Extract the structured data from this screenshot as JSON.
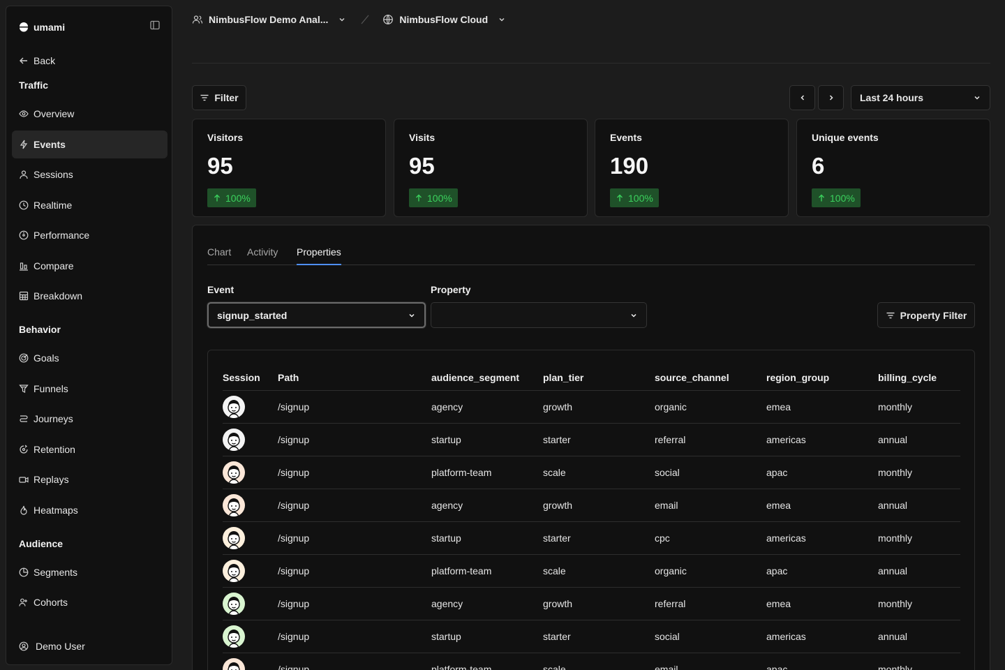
{
  "sidebar": {
    "brand": "umami",
    "back": "Back",
    "sections": {
      "traffic": "Traffic",
      "behavior": "Behavior",
      "audience": "Audience"
    },
    "traffic_items": [
      {
        "label": "Overview",
        "icon": "eye-icon"
      },
      {
        "label": "Events",
        "icon": "lightning-icon"
      },
      {
        "label": "Sessions",
        "icon": "user-icon"
      },
      {
        "label": "Realtime",
        "icon": "clock-icon"
      },
      {
        "label": "Performance",
        "icon": "gauge-icon"
      },
      {
        "label": "Compare",
        "icon": "compare-icon"
      },
      {
        "label": "Breakdown",
        "icon": "grid-icon"
      }
    ],
    "behavior_items": [
      {
        "label": "Goals",
        "icon": "target-icon"
      },
      {
        "label": "Funnels",
        "icon": "funnel-icon"
      },
      {
        "label": "Journeys",
        "icon": "journey-icon"
      },
      {
        "label": "Retention",
        "icon": "retention-icon"
      },
      {
        "label": "Replays",
        "icon": "video-icon"
      },
      {
        "label": "Heatmaps",
        "icon": "flame-icon"
      }
    ],
    "audience_items": [
      {
        "label": "Segments",
        "icon": "pie-icon"
      },
      {
        "label": "Cohorts",
        "icon": "users-icon"
      }
    ],
    "user": "Demo User"
  },
  "header": {
    "team": "NimbusFlow Demo Anal...",
    "website": "NimbusFlow Cloud"
  },
  "toolbar": {
    "filter": "Filter",
    "date_range": "Last 24 hours"
  },
  "metrics": [
    {
      "label": "Visitors",
      "value": "95",
      "change": "100%"
    },
    {
      "label": "Visits",
      "value": "95",
      "change": "100%"
    },
    {
      "label": "Events",
      "value": "190",
      "change": "100%"
    },
    {
      "label": "Unique events",
      "value": "6",
      "change": "100%"
    }
  ],
  "tabs": [
    "Chart",
    "Activity",
    "Properties"
  ],
  "active_tab": "Properties",
  "event_field": {
    "label": "Event",
    "value": "signup_started"
  },
  "property_field": {
    "label": "Property",
    "value": ""
  },
  "property_filter": "Property Filter",
  "table": {
    "columns": [
      "Session",
      "Path",
      "audience_segment",
      "plan_tier",
      "source_channel",
      "region_group",
      "billing_cycle"
    ],
    "rows": [
      {
        "avatar": "#f4f4f4",
        "path": "/signup",
        "audience_segment": "agency",
        "plan_tier": "growth",
        "source_channel": "organic",
        "region_group": "emea",
        "billing_cycle": "monthly"
      },
      {
        "avatar": "#f4f4f4",
        "path": "/signup",
        "audience_segment": "startup",
        "plan_tier": "starter",
        "source_channel": "referral",
        "region_group": "americas",
        "billing_cycle": "annual"
      },
      {
        "avatar": "#fbe7d8",
        "path": "/signup",
        "audience_segment": "platform-team",
        "plan_tier": "scale",
        "source_channel": "social",
        "region_group": "apac",
        "billing_cycle": "monthly"
      },
      {
        "avatar": "#fbe7d8",
        "path": "/signup",
        "audience_segment": "agency",
        "plan_tier": "growth",
        "source_channel": "email",
        "region_group": "emea",
        "billing_cycle": "annual"
      },
      {
        "avatar": "#fdf0dd",
        "path": "/signup",
        "audience_segment": "startup",
        "plan_tier": "starter",
        "source_channel": "cpc",
        "region_group": "americas",
        "billing_cycle": "monthly"
      },
      {
        "avatar": "#fdf0dd",
        "path": "/signup",
        "audience_segment": "platform-team",
        "plan_tier": "scale",
        "source_channel": "organic",
        "region_group": "apac",
        "billing_cycle": "annual"
      },
      {
        "avatar": "#d9f5d0",
        "path": "/signup",
        "audience_segment": "agency",
        "plan_tier": "growth",
        "source_channel": "referral",
        "region_group": "emea",
        "billing_cycle": "monthly"
      },
      {
        "avatar": "#d9f5d0",
        "path": "/signup",
        "audience_segment": "startup",
        "plan_tier": "starter",
        "source_channel": "social",
        "region_group": "americas",
        "billing_cycle": "annual"
      },
      {
        "avatar": "#fbe7d8",
        "path": "/signup",
        "audience_segment": "platform-team",
        "plan_tier": "scale",
        "source_channel": "email",
        "region_group": "apac",
        "billing_cycle": "monthly"
      }
    ]
  },
  "colors": {
    "accent": "#4f8ff7",
    "positive_text": "#3bd15d",
    "positive_bg": "#1f5129"
  }
}
